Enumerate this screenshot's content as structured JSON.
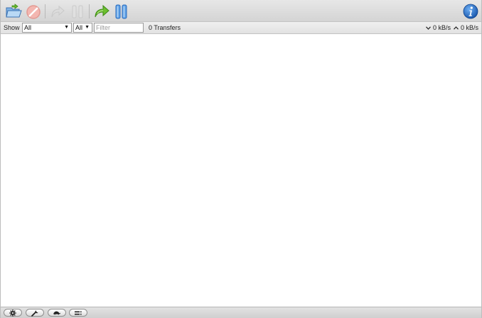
{
  "toolbar": {
    "buttons": [
      {
        "name": "open-torrent-button",
        "icon": "folder-open-icon",
        "enabled": true
      },
      {
        "name": "remove-button",
        "icon": "remove-icon",
        "enabled": false
      },
      {
        "name": "resume-button",
        "icon": "resume-arrow-icon",
        "enabled": false
      },
      {
        "name": "pause-button",
        "icon": "pause-icon",
        "enabled": false
      },
      {
        "name": "resume-all-button",
        "icon": "resume-all-arrow-icon",
        "enabled": true
      },
      {
        "name": "pause-all-button",
        "icon": "pause-all-icon",
        "enabled": true
      }
    ],
    "inspector_icon": "info-icon"
  },
  "filterbar": {
    "show_label": "Show",
    "status_filter": {
      "selected": "All"
    },
    "tracker_filter": {
      "selected": "All"
    },
    "filter_placeholder": "Filter",
    "transfers_count": "0 Transfers",
    "download_rate": "0 kB/s",
    "upload_rate": "0 kB/s"
  },
  "transfers": [],
  "bottombar": {
    "buttons": [
      {
        "name": "settings-button",
        "icon": "gear-icon"
      },
      {
        "name": "preferences-button",
        "icon": "wrench-icon"
      },
      {
        "name": "turtle-mode-button",
        "icon": "turtle-icon"
      },
      {
        "name": "compact-view-button",
        "icon": "list-icon"
      }
    ]
  },
  "colors": {
    "toolbar_green": "#6cbf2e",
    "toolbar_blue": "#3b84d8",
    "disabled": "#c9c9c9",
    "info_blue": "#1f6fd0"
  }
}
